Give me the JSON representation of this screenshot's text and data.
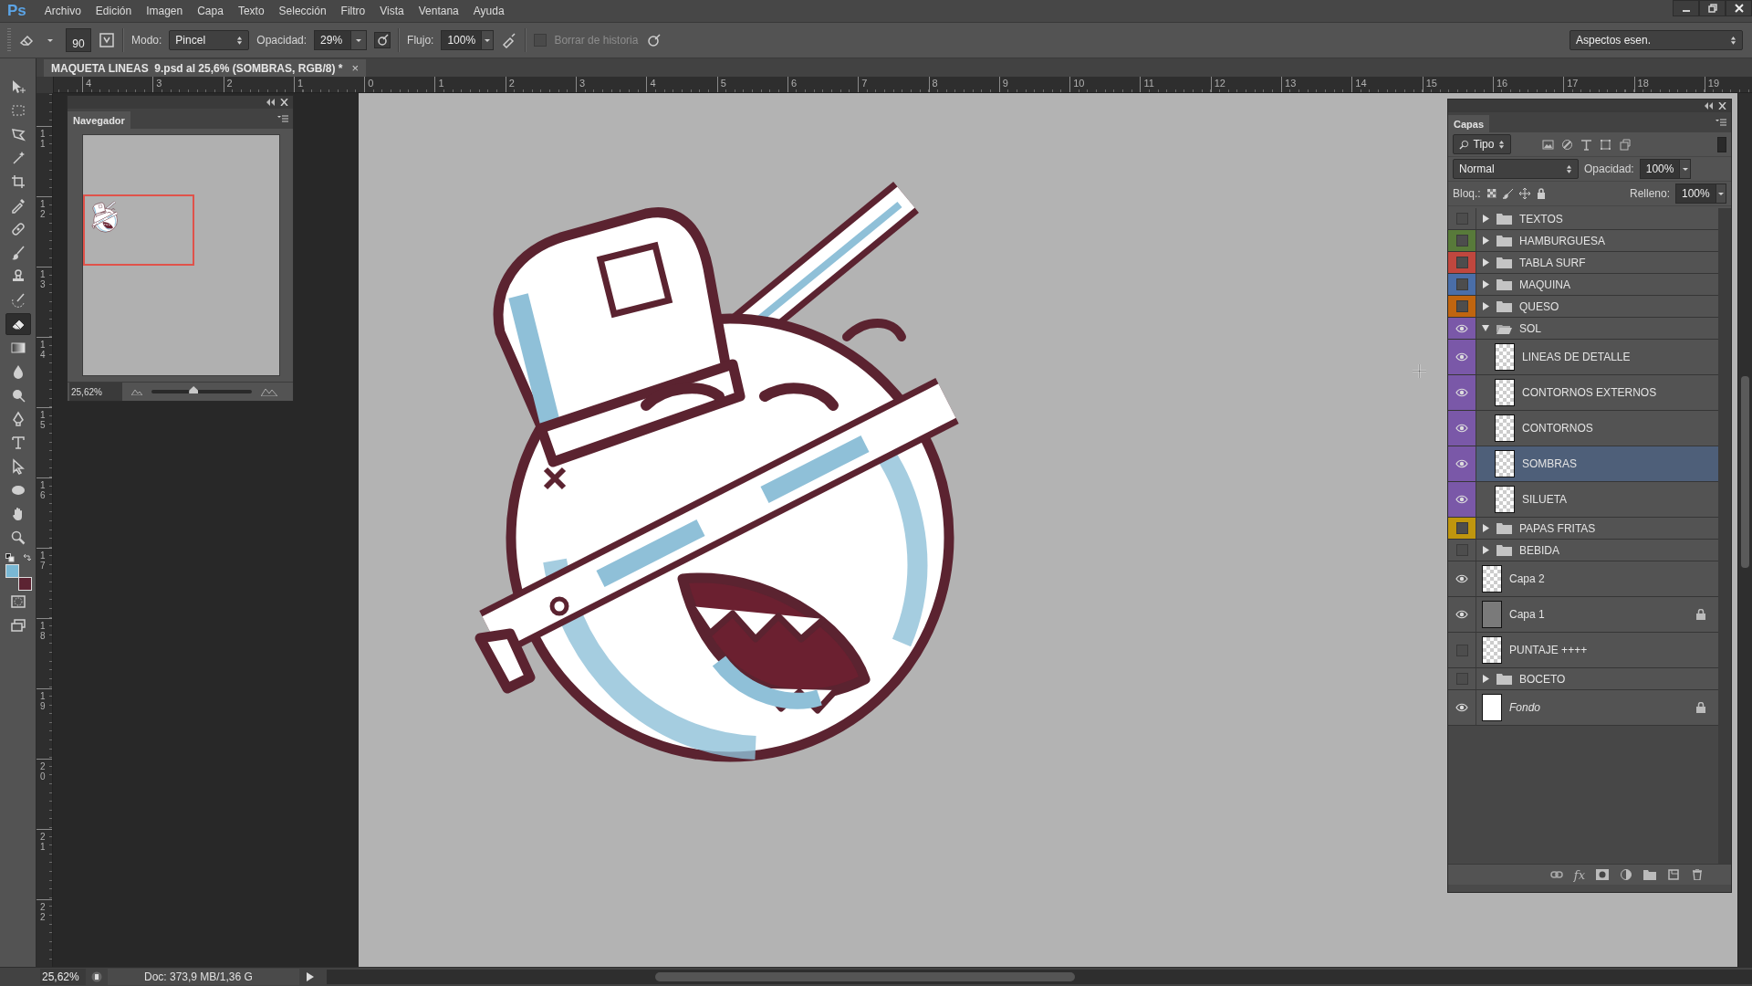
{
  "app": {
    "logo": "Ps"
  },
  "menu": [
    "Archivo",
    "Edición",
    "Imagen",
    "Capa",
    "Texto",
    "Selección",
    "Filtro",
    "Vista",
    "Ventana",
    "Ayuda"
  ],
  "options_bar": {
    "brush_size": "90",
    "mode_label": "Modo:",
    "mode": "Pincel",
    "opacity_label": "Opacidad:",
    "opacity": "29%",
    "flow_label": "Flujo:",
    "flow": "100%",
    "erase_history": {
      "label": "Borrar de historia",
      "checked": false
    },
    "workspace": "Aspectos esen."
  },
  "document_tab": {
    "title": "MAQUETA LINEAS  9.psd al 25,6% (SOMBRAS, RGB/8) *",
    "close": "×"
  },
  "tools": [
    {
      "kind": "move",
      "selected": false
    },
    {
      "kind": "marquee",
      "selected": false
    },
    {
      "kind": "lasso",
      "selected": false
    },
    {
      "kind": "wand",
      "selected": false
    },
    {
      "kind": "crop",
      "selected": false
    },
    {
      "kind": "eyedropper",
      "selected": false
    },
    {
      "kind": "healing",
      "selected": false
    },
    {
      "kind": "brush",
      "selected": false
    },
    {
      "kind": "stamp",
      "selected": false
    },
    {
      "kind": "history",
      "selected": false
    },
    {
      "kind": "eraser",
      "selected": true
    },
    {
      "kind": "gradient",
      "selected": false
    },
    {
      "kind": "blur",
      "selected": false
    },
    {
      "kind": "dodge",
      "selected": false
    },
    {
      "kind": "pen",
      "selected": false
    },
    {
      "kind": "type",
      "selected": false
    },
    {
      "kind": "pointer",
      "selected": false
    },
    {
      "kind": "ellipse",
      "selected": false
    },
    {
      "kind": "hand",
      "selected": false
    },
    {
      "kind": "zoom",
      "selected": false
    }
  ],
  "color_swatches": [
    {
      "kind": "foreground",
      "color": "#7ab8d4"
    },
    {
      "kind": "background",
      "color": "#5c2332"
    }
  ],
  "ruler_h": [
    "4",
    "3",
    "2",
    "1",
    "0",
    "1",
    "2",
    "3",
    "4",
    "5",
    "6",
    "7",
    "8",
    "9",
    "10",
    "11",
    "12",
    "13",
    "14",
    "15",
    "16",
    "17",
    "18",
    "19"
  ],
  "ruler_v": [
    "11",
    "12",
    "13",
    "14",
    "15",
    "16",
    "17",
    "18",
    "19",
    "20",
    "21",
    "22"
  ],
  "navigator": {
    "title": "Navegador",
    "zoom": "25,62%",
    "level": 0.42
  },
  "layers_panel": {
    "title": "Capas",
    "filter": "Tipo",
    "blend_mode": "Normal",
    "opacity_label": "Opacidad:",
    "opacity": "100%",
    "lock_label": "Bloq.:",
    "fill_label": "Relleno:",
    "fill": "100%",
    "fx": "fx",
    "layers": [
      {
        "name": "TEXTOS",
        "kind": "group",
        "visible": false,
        "expanded": false,
        "selected": false,
        "locked": false
      },
      {
        "name": "HAMBURGUESA",
        "kind": "group",
        "visible": false,
        "color": "#587a3a",
        "expanded": false,
        "selected": false,
        "locked": false
      },
      {
        "name": "TABLA SURF",
        "kind": "group",
        "visible": false,
        "color": "#c0473e",
        "expanded": false,
        "selected": false,
        "locked": false
      },
      {
        "name": "MAQUINA",
        "kind": "group",
        "visible": false,
        "color": "#4a6ea8",
        "expanded": false,
        "selected": false,
        "locked": false
      },
      {
        "name": "QUESO",
        "kind": "group",
        "visible": false,
        "color": "#c0650f",
        "expanded": false,
        "selected": false,
        "locked": false
      },
      {
        "name": "SOL",
        "kind": "group",
        "visible": true,
        "color": "#7a58a8",
        "expanded": true,
        "selected": false,
        "locked": false,
        "children": [
          {
            "name": "LINEAS DE DETALLE",
            "kind": "pixel",
            "visible": true,
            "color": "#7a58a8",
            "selected": false,
            "locked": false
          },
          {
            "name": "CONTORNOS EXTERNOS",
            "kind": "pixel",
            "visible": true,
            "color": "#7a58a8",
            "selected": false,
            "locked": false
          },
          {
            "name": "CONTORNOS",
            "kind": "pixel",
            "visible": true,
            "color": "#7a58a8",
            "selected": false,
            "locked": false
          },
          {
            "name": "SOMBRAS",
            "kind": "pixel",
            "visible": true,
            "color": "#7a58a8",
            "selected": true,
            "locked": false
          },
          {
            "name": "SILUETA",
            "kind": "pixel",
            "visible": true,
            "color": "#7a58a8",
            "selected": false,
            "locked": false
          }
        ]
      },
      {
        "name": "PAPAS FRITAS",
        "kind": "group",
        "visible": false,
        "color": "#bf960e",
        "expanded": false,
        "selected": false,
        "locked": false
      },
      {
        "name": "BEBIDA",
        "kind": "group",
        "visible": false,
        "expanded": false,
        "selected": false,
        "locked": false
      },
      {
        "name": "Capa 2",
        "kind": "pixel",
        "visible": true,
        "selected": false,
        "locked": false
      },
      {
        "name": "Capa 1",
        "kind": "solid",
        "visible": true,
        "selected": false,
        "locked": true
      },
      {
        "name": "PUNTAJE ++++",
        "kind": "pixel",
        "visible": false,
        "selected": false,
        "locked": false
      },
      {
        "name": "BOCETO",
        "kind": "group",
        "visible": false,
        "expanded": false,
        "selected": false,
        "locked": false
      },
      {
        "name": "Fondo",
        "kind": "background",
        "visible": true,
        "selected": false,
        "locked": true
      }
    ]
  },
  "status_bar": {
    "zoom": "25,62%",
    "doc_info": "Doc: 373,9 MB/1,36 G"
  }
}
